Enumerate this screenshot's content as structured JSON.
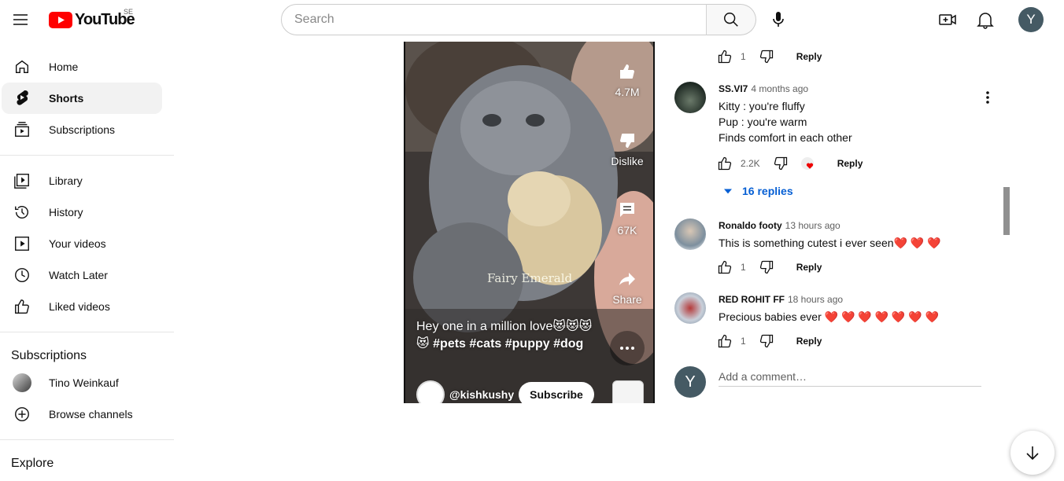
{
  "header": {
    "logo_text": "YouTube",
    "country_code": "SE",
    "search_placeholder": "Search",
    "user_initial": "Y",
    "icons": [
      "menu-icon",
      "youtube-logo-icon",
      "search-icon",
      "mic-icon",
      "create-icon",
      "bell-icon"
    ]
  },
  "sidebar": {
    "items": [
      {
        "label": "Home",
        "icon": "home-icon"
      },
      {
        "label": "Shorts",
        "icon": "shorts-icon",
        "active": true
      },
      {
        "label": "Subscriptions",
        "icon": "subscriptions-icon"
      },
      {
        "label": "Library",
        "icon": "library-icon"
      },
      {
        "label": "History",
        "icon": "history-icon"
      },
      {
        "label": "Your videos",
        "icon": "your-videos-icon"
      },
      {
        "label": "Watch Later",
        "icon": "watch-later-icon"
      },
      {
        "label": "Liked videos",
        "icon": "liked-videos-icon"
      }
    ],
    "subscriptions_heading": "Subscriptions",
    "subscriptions": [
      {
        "label": "Tino Weinkauf"
      },
      {
        "label": "Browse channels",
        "icon": "add-circle-icon"
      }
    ],
    "explore_heading": "Explore"
  },
  "video": {
    "likes": "4.7M",
    "dislike_label": "Dislike",
    "comments": "67K",
    "share_label": "Share",
    "caption_text": "Hey one in a million love😻😻😻😻",
    "hashtags": "#pets #cats #puppy #dog",
    "watermark": "Fairy Emerald",
    "channel": "@kishkushy",
    "subscribe_label": "Subscribe"
  },
  "comments": {
    "prev_like_count": "1",
    "reply_label": "Reply",
    "items": [
      {
        "author": "SS.VI7",
        "time": "4 months ago",
        "lines": [
          "Kitty : you're fluffy",
          "Pup : you're warm",
          "Finds comfort in each other"
        ],
        "likes": "2.2K",
        "replies_toggle": "16 replies"
      },
      {
        "author": "Ronaldo footy",
        "time": "13 hours ago",
        "text": "This is something cutest i ever seen❤️ ❤️ ❤️",
        "likes": "1"
      },
      {
        "author": "RED ROHIT FF",
        "time": "18 hours ago",
        "text": "Precious babies ever ❤️ ❤️ ❤️ ❤️ ❤️ ❤️ ❤️",
        "likes": "1"
      }
    ],
    "add_placeholder": "Add a comment…",
    "my_initial": "Y"
  }
}
